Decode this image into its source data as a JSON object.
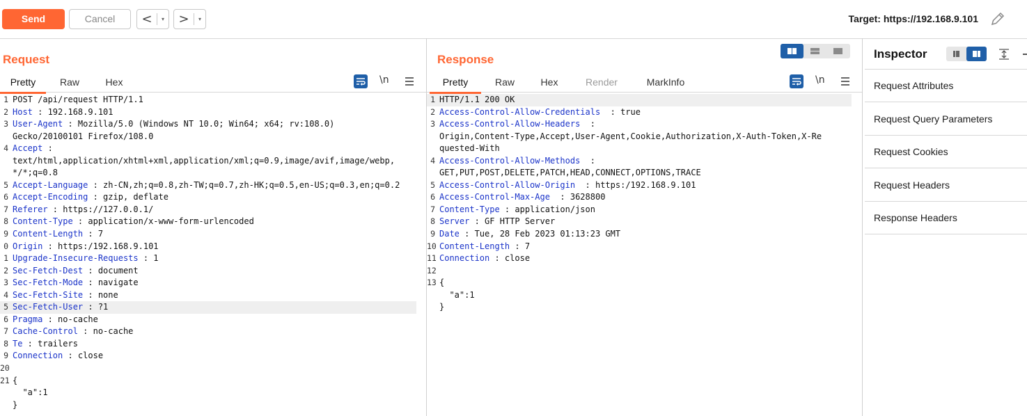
{
  "toolbar": {
    "send_label": "Send",
    "cancel_label": "Cancel",
    "back_label": "<",
    "forward_label": ">",
    "dropdown_glyph": "▾",
    "target_text": "Target: https://192.168.9.101",
    "accent_color": "#ff6633"
  },
  "request": {
    "title": "Request",
    "tabs": [
      {
        "label": "Pretty",
        "active": true
      },
      {
        "label": "Raw"
      },
      {
        "label": "Hex"
      }
    ],
    "icons": [
      "wrap-lines-icon",
      "newline-toggle-icon",
      "menu-icon"
    ],
    "newline_label": "\\n",
    "lines": [
      {
        "n": "1",
        "key": "",
        "text": "POST /api/request HTTP/1.1"
      },
      {
        "n": "2",
        "key": "Host",
        "text": ": 192.168.9.101"
      },
      {
        "n": "3",
        "key": "User-Agent",
        "text": ": Mozilla/5.0 (Windows NT 10.0; Win64; x64; rv:108.0)"
      },
      {
        "n": "",
        "key": "",
        "text": "Gecko/20100101 Firefox/108.0"
      },
      {
        "n": "4",
        "key": "Accept",
        "text": ":"
      },
      {
        "n": "",
        "key": "",
        "text": "text/html,application/xhtml+xml,application/xml;q=0.9,image/avif,image/webp,"
      },
      {
        "n": "",
        "key": "",
        "text": "*/*;q=0.8"
      },
      {
        "n": "5",
        "key": "Accept-Language",
        "text": ": zh-CN,zh;q=0.8,zh-TW;q=0.7,zh-HK;q=0.5,en-US;q=0.3,en;q=0.2"
      },
      {
        "n": "6",
        "key": "Accept-Encoding",
        "text": ": gzip, deflate"
      },
      {
        "n": "7",
        "key": "Referer",
        "text": ": https://127.0.0.1/"
      },
      {
        "n": "8",
        "key": "Content-Type",
        "text": ": application/x-www-form-urlencoded"
      },
      {
        "n": "9",
        "key": "Content-Length",
        "text": ": 7"
      },
      {
        "n": "0",
        "key": "Origin",
        "text": ": https:/192.168.9.101"
      },
      {
        "n": "1",
        "key": "Upgrade-Insecure-Requests",
        "text": ": 1"
      },
      {
        "n": "2",
        "key": "Sec-Fetch-Dest",
        "text": ": document"
      },
      {
        "n": "3",
        "key": "Sec-Fetch-Mode",
        "text": ": navigate"
      },
      {
        "n": "4",
        "key": "Sec-Fetch-Site",
        "text": ": none"
      },
      {
        "n": "5",
        "key": "Sec-Fetch-User",
        "text": ": ?1",
        "highlight": true
      },
      {
        "n": "6",
        "key": "Pragma",
        "text": ": no-cache"
      },
      {
        "n": "7",
        "key": "Cache-Control",
        "text": ": no-cache"
      },
      {
        "n": "8",
        "key": "Te",
        "text": ": trailers"
      },
      {
        "n": "9",
        "key": "Connection",
        "text": ": close"
      },
      {
        "n": "20",
        "key": "",
        "text": ""
      },
      {
        "n": "21",
        "key": "",
        "text": "{"
      },
      {
        "n": "",
        "key": "",
        "text": "  \"a\":1"
      },
      {
        "n": "",
        "key": "",
        "text": "}"
      }
    ]
  },
  "response": {
    "title": "Response",
    "tabs": [
      {
        "label": "Pretty",
        "active": true
      },
      {
        "label": "Raw"
      },
      {
        "label": "Hex"
      },
      {
        "label": "Render",
        "disabled": true
      },
      {
        "label": "MarkInfo"
      }
    ],
    "icons": [
      "wrap-lines-icon",
      "newline-toggle-icon",
      "menu-icon"
    ],
    "newline_label": "\\n",
    "layout_modes": [
      "split-horizontal-icon",
      "split-vertical-icon",
      "single-pane-icon"
    ],
    "lines": [
      {
        "n": "1",
        "key": "",
        "text": "HTTP/1.1 200 OK",
        "highlight": true
      },
      {
        "n": "2",
        "key": "Access-Control-Allow-Credentials",
        "text": " : true"
      },
      {
        "n": "3",
        "key": "Access-Control-Allow-Headers",
        "text": " :"
      },
      {
        "n": "",
        "key": "",
        "text": "Origin,Content-Type,Accept,User-Agent,Cookie,Authorization,X-Auth-Token,X-Re"
      },
      {
        "n": "",
        "key": "",
        "text": "quested-With"
      },
      {
        "n": "4",
        "key": "Access-Control-Allow-Methods",
        "text": " :"
      },
      {
        "n": "",
        "key": "",
        "text": "GET,PUT,POST,DELETE,PATCH,HEAD,CONNECT,OPTIONS,TRACE"
      },
      {
        "n": "5",
        "key": "Access-Control-Allow-Origin",
        "text": " : https:/192.168.9.101"
      },
      {
        "n": "6",
        "key": "Access-Control-Max-Age",
        "text": " : 3628800"
      },
      {
        "n": "7",
        "key": "Content-Type",
        "text": ": application/json"
      },
      {
        "n": "8",
        "key": "Server",
        "text": ": GF HTTP Server"
      },
      {
        "n": "9",
        "key": "Date",
        "text": ": Tue, 28 Feb 2023 01:13:23 GMT"
      },
      {
        "n": "10",
        "key": "Content-Length",
        "text": ": 7"
      },
      {
        "n": "11",
        "key": "Connection",
        "text": ": close"
      },
      {
        "n": "12",
        "key": "",
        "text": ""
      },
      {
        "n": "13",
        "key": "",
        "text": "{"
      },
      {
        "n": "",
        "key": "",
        "text": "  \"a\":1"
      },
      {
        "n": "",
        "key": "",
        "text": "}"
      }
    ]
  },
  "inspector": {
    "title": "Inspector",
    "items": [
      "Request Attributes",
      "Request Query Parameters",
      "Request Cookies",
      "Request Headers",
      "Response Headers"
    ]
  }
}
